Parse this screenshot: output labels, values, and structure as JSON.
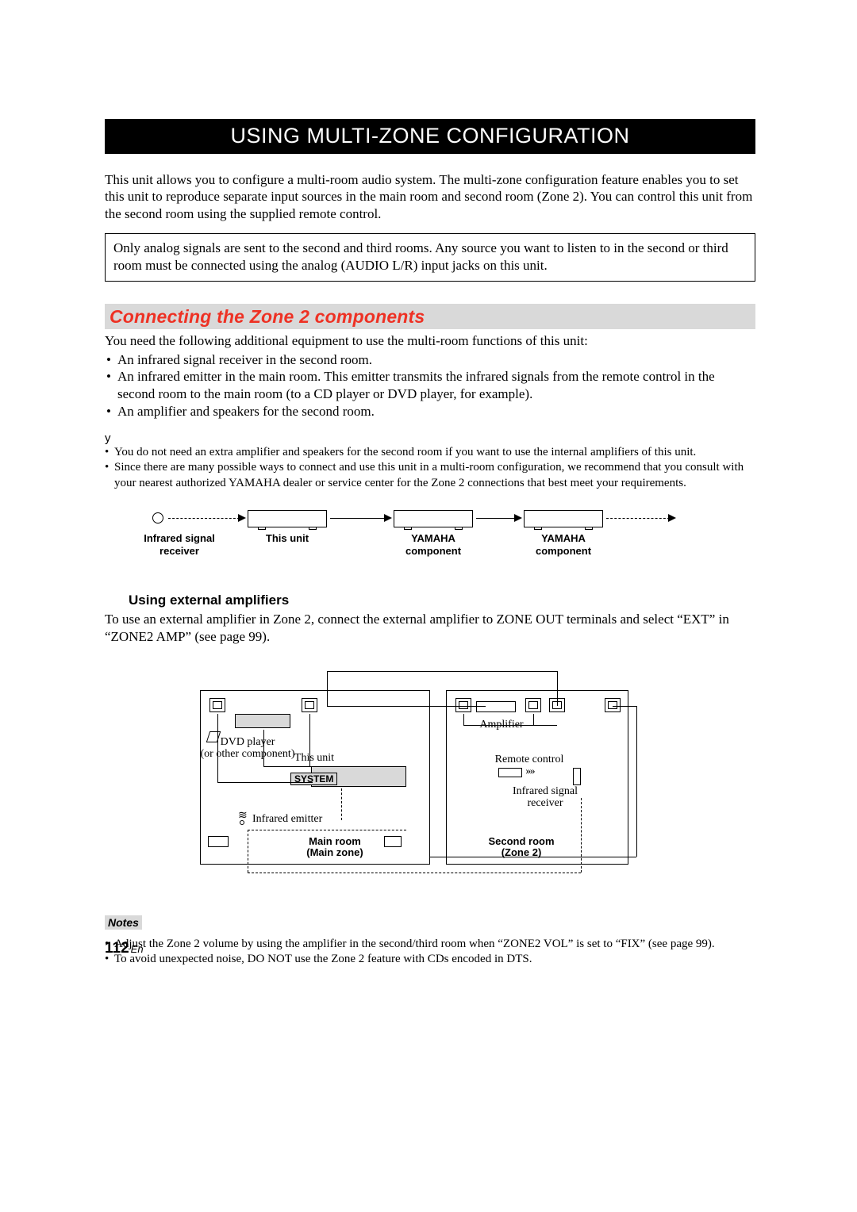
{
  "main_title": "USING MULTI-ZONE CONFIGURATION",
  "intro": "This unit allows you to configure a multi-room audio system. The multi-zone configuration feature enables you to set this unit to reproduce separate input sources in the main room and second room (Zone 2). You can control this unit from the second room using the supplied remote control.",
  "callout": "Only analog signals are sent to the second and third rooms. Any source you want to listen to in the second or third room must be connected using the analog (AUDIO L/R) input jacks on this unit.",
  "section_title": "Connecting the Zone 2 components",
  "need_para": "You need the following additional equipment to use the multi-room functions of this unit:",
  "need_bullets": [
    "An infrared signal receiver in the second room.",
    "An infrared emitter in the main room. This emitter transmits the infrared signals from the remote control in the second room to the main room (to a CD player or DVD player, for example).",
    "An amplifier and speakers for the second room."
  ],
  "tip_marker": "y",
  "tip_bullets": [
    "You do not need an extra amplifier and speakers for the second room if you want to use the internal amplifiers of this unit.",
    "Since there are many possible ways to connect and use this unit in a multi-room configuration, we recommend that you consult with your nearest authorized YAMAHA dealer or service center for the Zone 2 connections that best meet your requirements."
  ],
  "diagram1": {
    "ir_receiver_label": "Infrared signal\nreceiver",
    "this_unit_label": "This unit",
    "component_a_label": "YAMAHA\ncomponent",
    "component_b_label": "YAMAHA\ncomponent"
  },
  "sub_heading": "Using external amplifiers",
  "sub_para": "To use an external amplifier in Zone 2, connect the external amplifier to ZONE OUT terminals and select “EXT” in “ZONE2 AMP” (see page 99).",
  "diagram2": {
    "dvd_label": "DVD player\n(or other component)",
    "this_unit_label": "This unit",
    "system_tag": "SYSTEM",
    "ir_emitter_label": "Infrared emitter",
    "main_room_label": "Main room\n(Main zone)",
    "amplifier_label": "Amplifier",
    "remote_label": "Remote control",
    "ir_receiver_label": "Infrared signal\nreceiver",
    "second_room_label": "Second room\n(Zone 2)"
  },
  "notes_label": "Notes",
  "notes": [
    "Adjust the Zone 2 volume by using the amplifier in the second/third room when “ZONE2 VOL” is set to “FIX” (see page 99).",
    "To avoid unexpected noise, DO NOT use the Zone 2 feature with CDs encoded in DTS."
  ],
  "page_number": "112",
  "page_lang": "En"
}
